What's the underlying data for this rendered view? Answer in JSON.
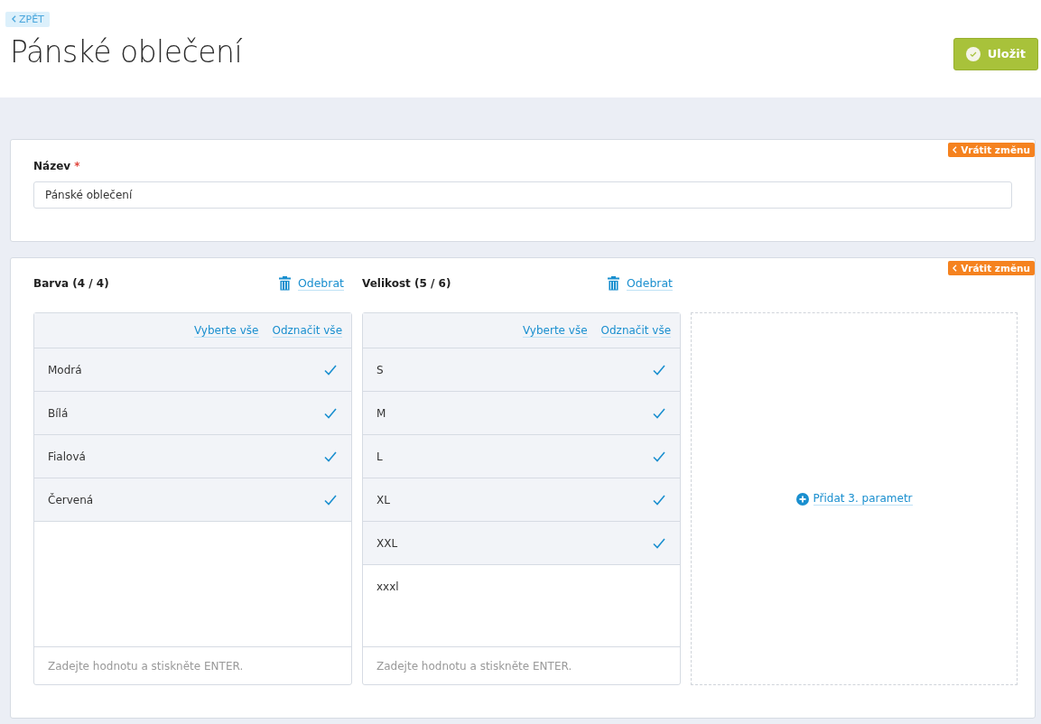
{
  "back_link": "ZPĚT",
  "title": "Pánské oblečení",
  "save_button": "Uložit",
  "name_card": {
    "revert": "Vrátit změnu",
    "label": "Název",
    "required_mark": "*",
    "value": "Pánské oblečení"
  },
  "params_card": {
    "revert": "Vrátit změnu",
    "parameters": [
      {
        "title": "Barva (4 / 4)",
        "remove": "Odebrat",
        "select_all": "Vyberte vše",
        "deselect_all": "Odznačit vše",
        "placeholder": "Zadejte hodnotu a stiskněte ENTER.",
        "values": [
          {
            "label": "Modrá",
            "selected": true
          },
          {
            "label": "Bílá",
            "selected": true
          },
          {
            "label": "Fialová",
            "selected": true
          },
          {
            "label": "Červená",
            "selected": true
          }
        ]
      },
      {
        "title": "Velikost (5 / 6)",
        "remove": "Odebrat",
        "select_all": "Vyberte vše",
        "deselect_all": "Odznačit vše",
        "placeholder": "Zadejte hodnotu a stiskněte ENTER.",
        "values": [
          {
            "label": "S",
            "selected": true
          },
          {
            "label": "M",
            "selected": true
          },
          {
            "label": "L",
            "selected": true
          },
          {
            "label": "XL",
            "selected": true
          },
          {
            "label": "XXL",
            "selected": true
          },
          {
            "label": "xxxl",
            "selected": false
          }
        ]
      }
    ],
    "add_parameter": "Přidat 3. parametr"
  }
}
